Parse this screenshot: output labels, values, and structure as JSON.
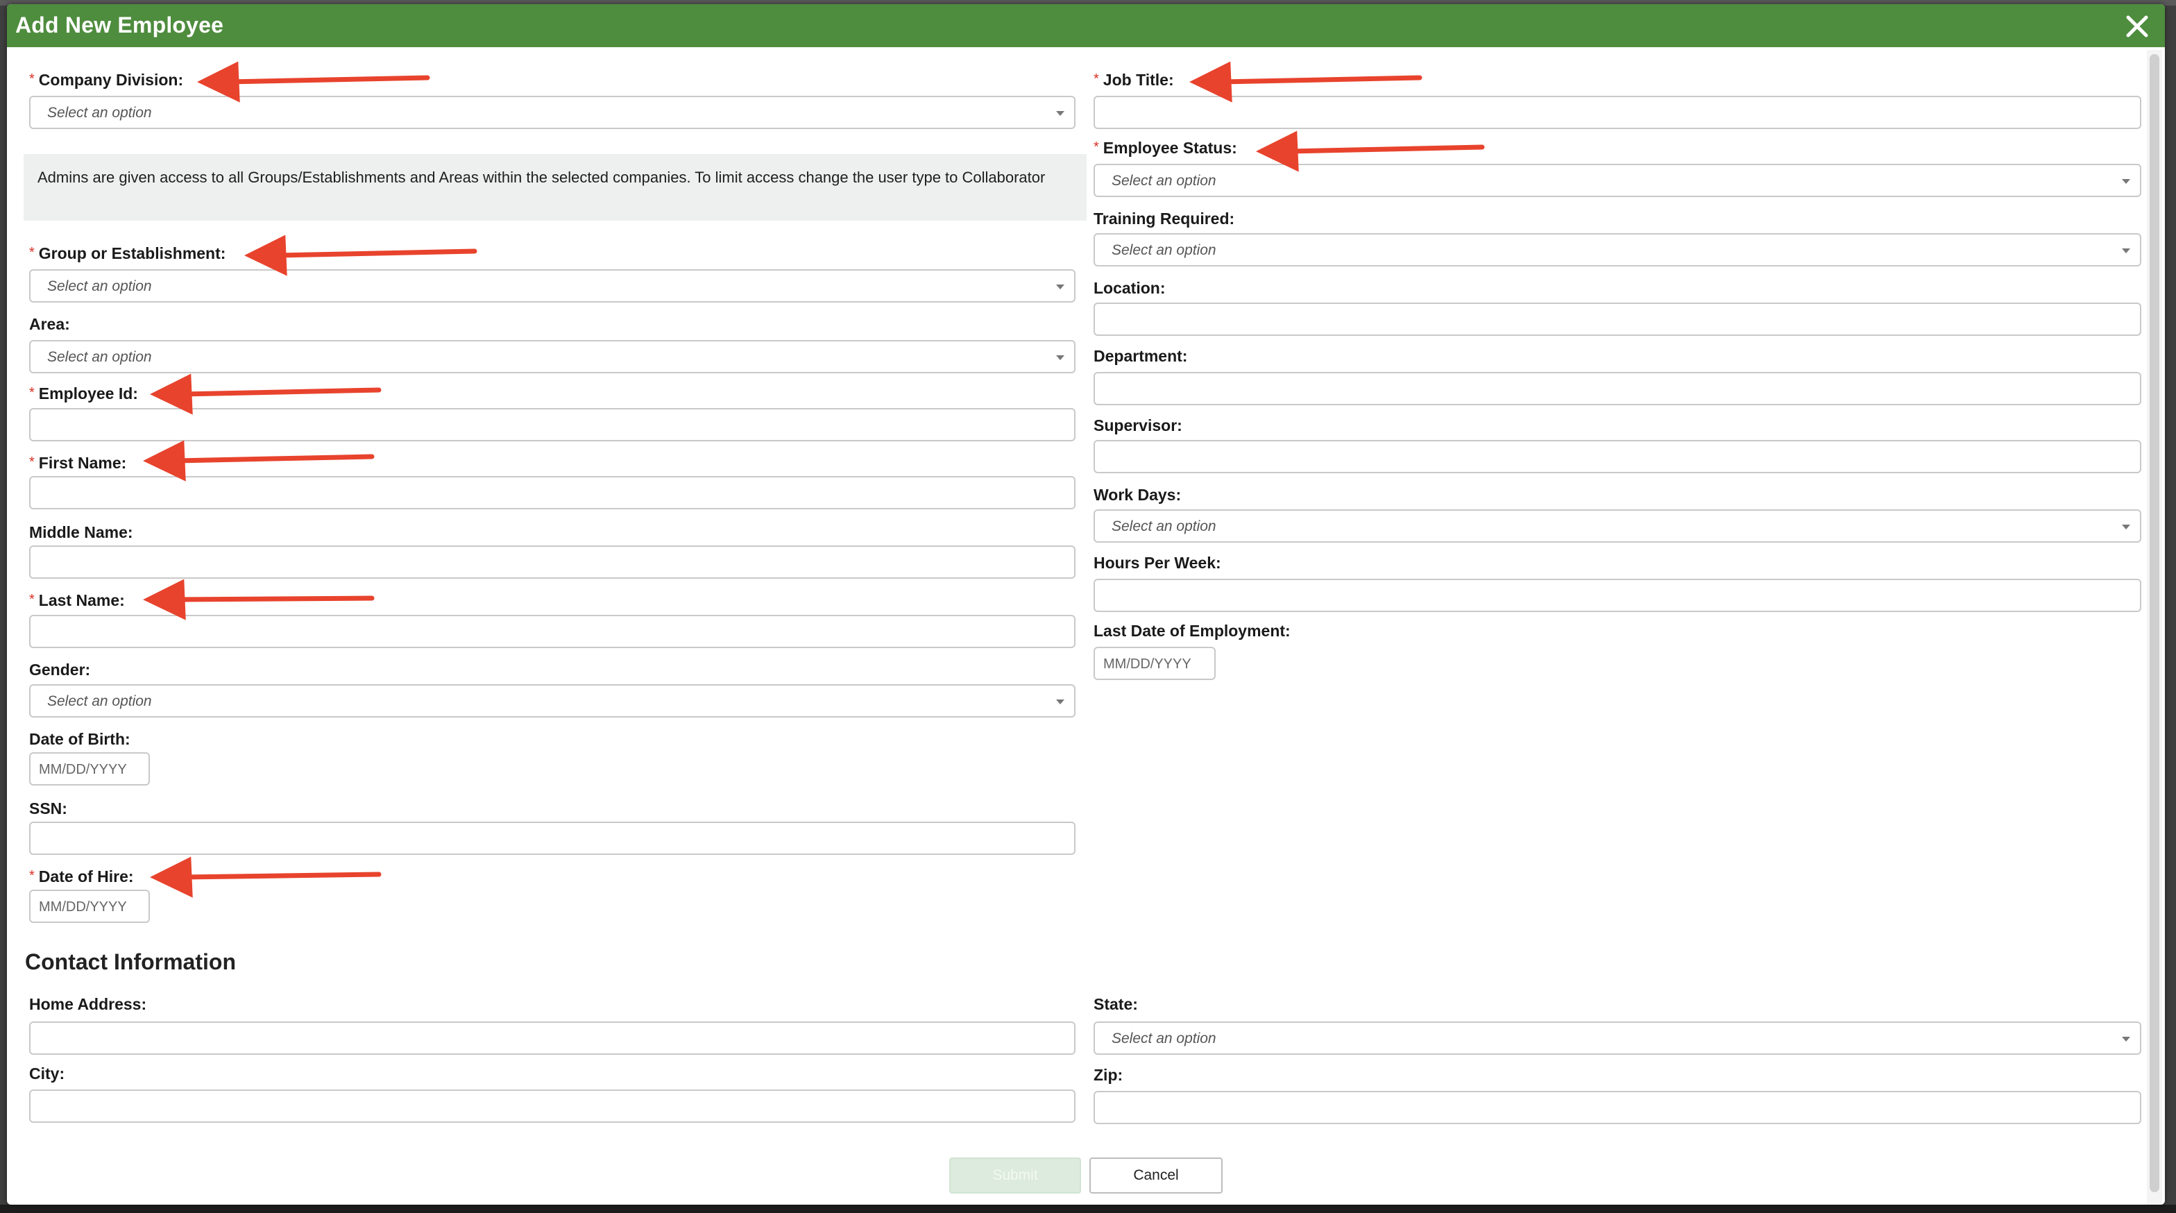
{
  "modal": {
    "title": "Add New Employee",
    "colors": {
      "header": "#4e8c3e",
      "required": "#d93025",
      "annotation_arrow": "#e8432d"
    }
  },
  "left": {
    "company_division": {
      "label": "Company Division:",
      "placeholder": "Select an option"
    },
    "notice": "Admins are given access to all Groups/Establishments and Areas within the selected companies. To limit access change the user type to Collaborator",
    "group_or_establishment": {
      "label": "Group or Establishment:",
      "placeholder": "Select an option"
    },
    "area": {
      "label": "Area:",
      "placeholder": "Select an option"
    },
    "employee_id": {
      "label": "Employee Id:"
    },
    "first_name": {
      "label": "First Name:"
    },
    "middle_name": {
      "label": "Middle Name:"
    },
    "last_name": {
      "label": "Last Name:"
    },
    "gender": {
      "label": "Gender:",
      "placeholder": "Select an option"
    },
    "date_of_birth": {
      "label": "Date of Birth:",
      "placeholder": "MM/DD/YYYY"
    },
    "ssn": {
      "label": "SSN:"
    },
    "date_of_hire": {
      "label": "Date of Hire:",
      "placeholder": "MM/DD/YYYY"
    }
  },
  "right": {
    "job_title": {
      "label": "Job Title:"
    },
    "employee_status": {
      "label": "Employee Status:",
      "placeholder": "Select an option"
    },
    "training_required": {
      "label": "Training Required:",
      "placeholder": "Select an option"
    },
    "location": {
      "label": "Location:"
    },
    "department": {
      "label": "Department:"
    },
    "supervisor": {
      "label": "Supervisor:"
    },
    "work_days": {
      "label": "Work Days:",
      "placeholder": "Select an option"
    },
    "hours_per_week": {
      "label": "Hours Per Week:"
    },
    "last_date_of_employment": {
      "label": "Last Date of Employment:",
      "placeholder": "MM/DD/YYYY"
    }
  },
  "contact": {
    "heading": "Contact Information",
    "home_address": {
      "label": "Home Address:"
    },
    "city": {
      "label": "City:"
    },
    "state": {
      "label": "State:",
      "placeholder": "Select an option"
    },
    "zip": {
      "label": "Zip:"
    }
  },
  "buttons": {
    "submit": "Submit",
    "cancel": "Cancel"
  },
  "required_marker": "*"
}
